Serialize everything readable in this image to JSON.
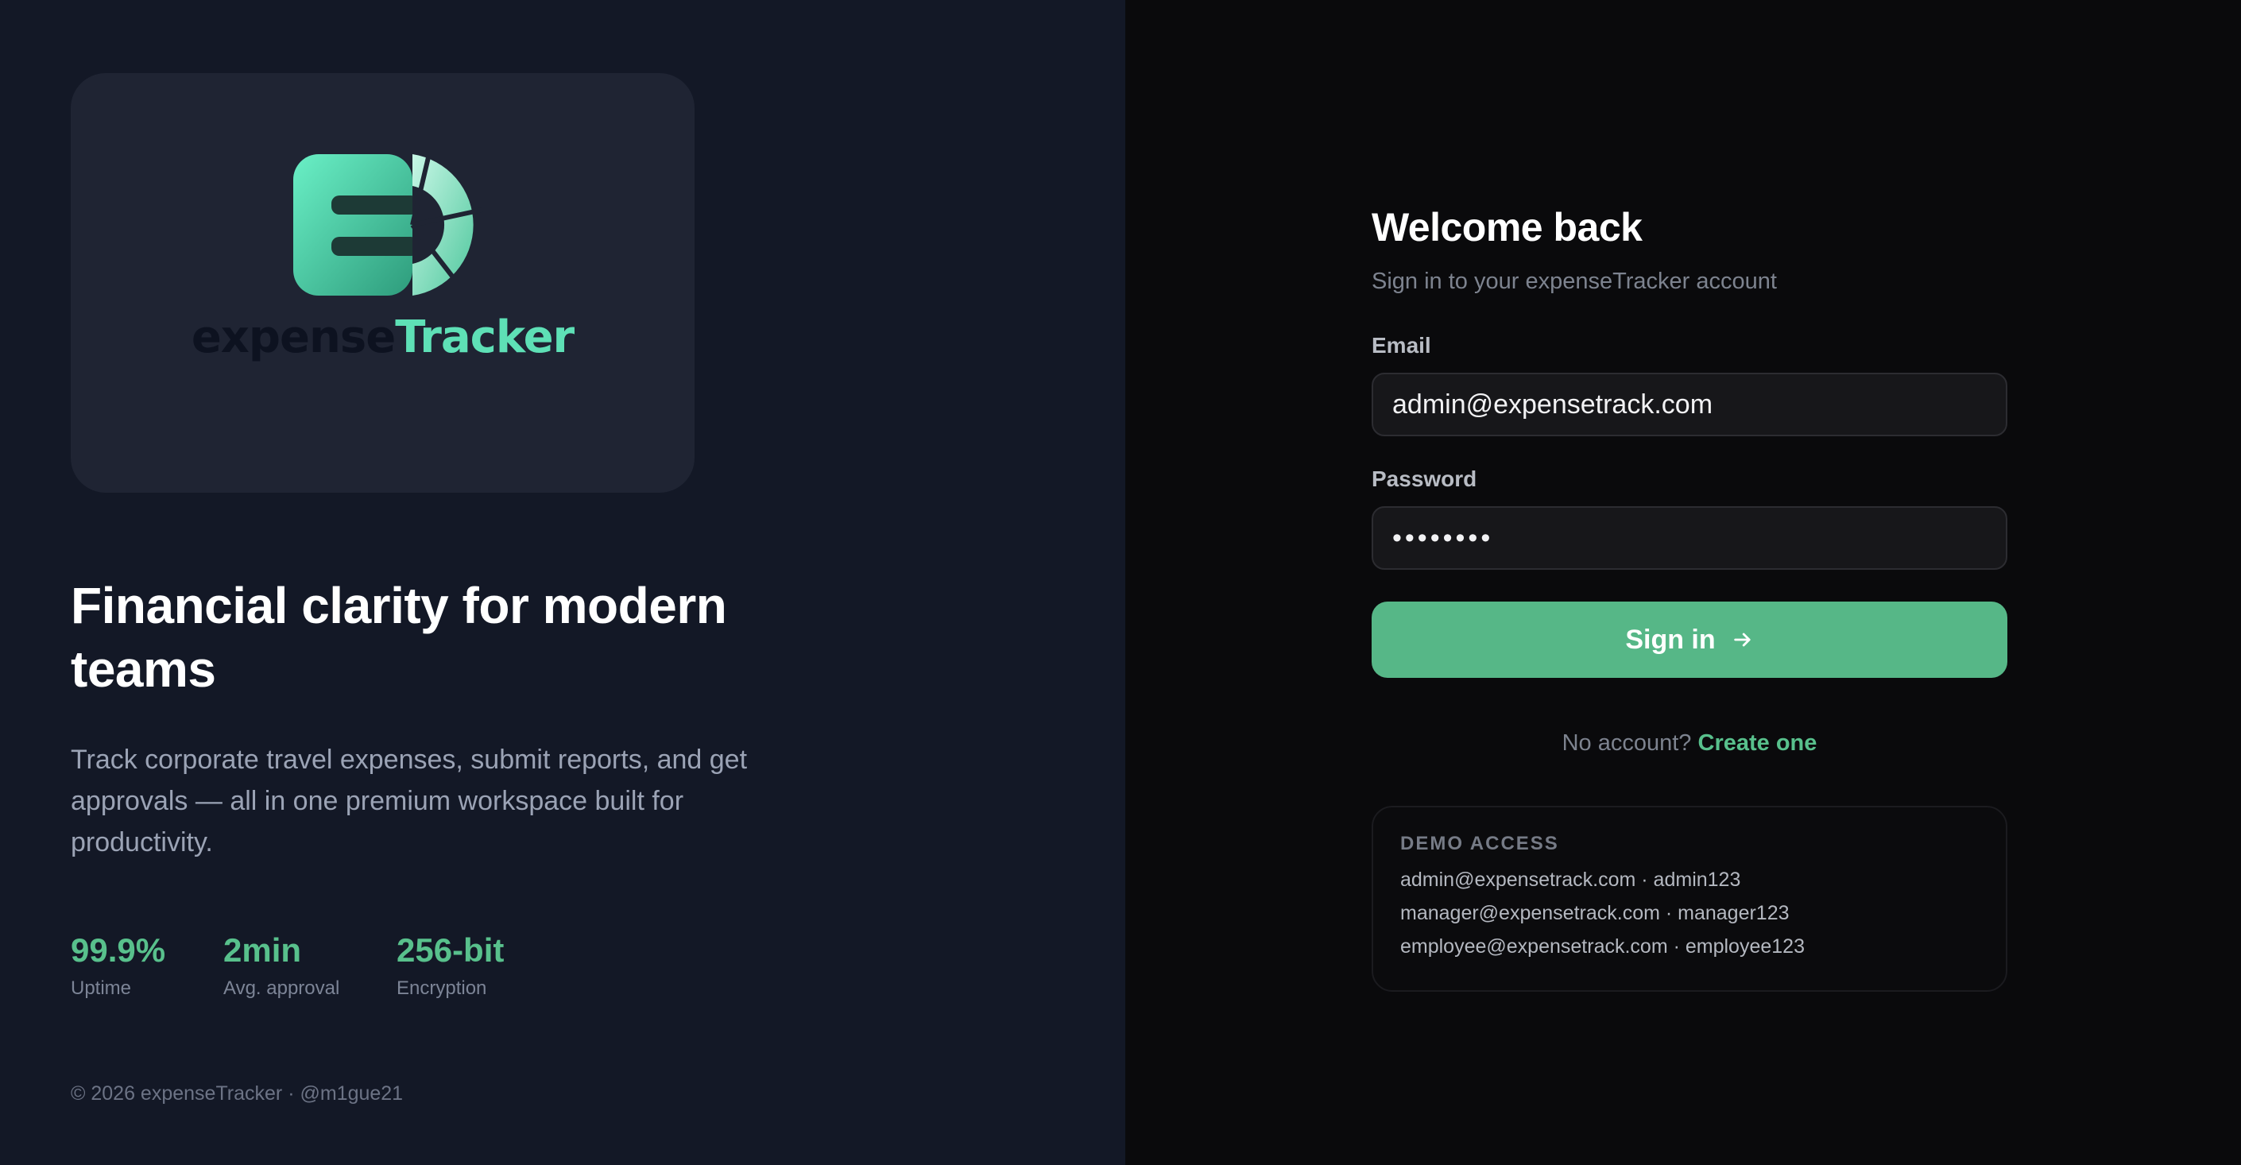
{
  "brand": {
    "word_part1": "expense",
    "word_part2": "Tracker",
    "colors": {
      "accent": "#58c08c",
      "logo_mint": "#5ee0b6",
      "left_bg": "#131826",
      "right_bg": "#0a0a0c"
    }
  },
  "hero": {
    "headline": "Financial clarity for modern teams",
    "description": "Track corporate travel expenses, submit reports, and get approvals — all in one premium workspace built for productivity."
  },
  "stats": [
    {
      "value": "99.9%",
      "label": "Uptime"
    },
    {
      "value": "2min",
      "label": "Avg. approval"
    },
    {
      "value": "256-bit",
      "label": "Encryption"
    }
  ],
  "footer": {
    "text": "© 2026 expenseTracker · @m1gue21"
  },
  "login": {
    "title": "Welcome back",
    "subtitle": "Sign in to your expenseTracker account",
    "email_label": "Email",
    "email_value": "admin@expensetrack.com",
    "password_label": "Password",
    "password_value": "••••••••",
    "submit_label": "Sign in",
    "submit_icon": "arrow-right-icon",
    "no_account_text": "No account?",
    "create_link": "Create one"
  },
  "demo": {
    "heading": "DEMO ACCESS",
    "credentials": [
      "admin@expensetrack.com · admin123",
      "manager@expensetrack.com · manager123",
      "employee@expensetrack.com · employee123"
    ]
  }
}
